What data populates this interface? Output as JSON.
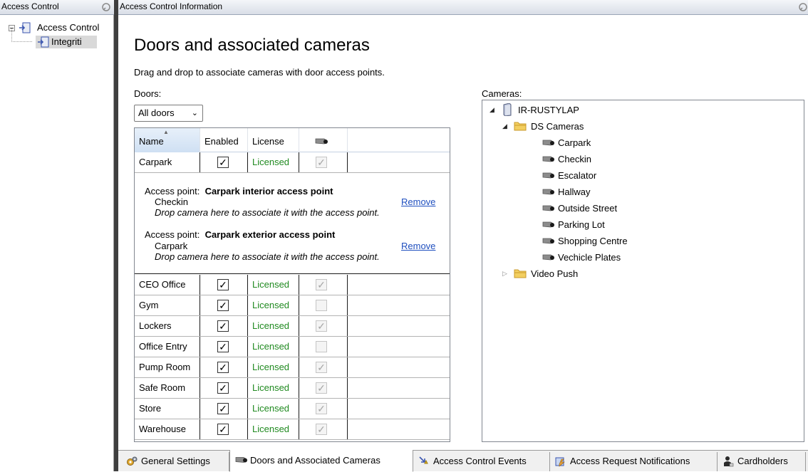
{
  "left_pane": {
    "header": "Access Control",
    "tree": {
      "root": "Access Control",
      "child": "Integriti"
    }
  },
  "right_pane": {
    "header": "Access Control Information",
    "title": "Doors and associated cameras",
    "subtitle": "Drag and drop to associate cameras with door access points.",
    "doors_label": "Doors:",
    "doors_filter": "All doors",
    "cameras_label": "Cameras:"
  },
  "doors_table": {
    "columns": [
      "Name",
      "Enabled",
      "License"
    ],
    "license_text": "Licensed",
    "rows": [
      {
        "name": "Carpark",
        "enabled": true,
        "license": "Licensed",
        "camera": true
      },
      {
        "name": "CEO Office",
        "enabled": true,
        "license": "Licensed",
        "camera": true
      },
      {
        "name": "Gym",
        "enabled": true,
        "license": "Licensed",
        "camera": false
      },
      {
        "name": "Lockers",
        "enabled": true,
        "license": "Licensed",
        "camera": true
      },
      {
        "name": "Office Entry",
        "enabled": true,
        "license": "Licensed",
        "camera": false
      },
      {
        "name": "Pump Room",
        "enabled": true,
        "license": "Licensed",
        "camera": true
      },
      {
        "name": "Safe Room",
        "enabled": true,
        "license": "Licensed",
        "camera": true
      },
      {
        "name": "Store",
        "enabled": true,
        "license": "Licensed",
        "camera": true
      },
      {
        "name": "Warehouse",
        "enabled": true,
        "license": "Licensed",
        "camera": true
      }
    ],
    "carpark_details": {
      "access_points": [
        {
          "prefix": "Access point:",
          "name": "Carpark interior access point",
          "camera": "Checkin",
          "drop_hint": "Drop camera here to associate it with the access point.",
          "remove": "Remove"
        },
        {
          "prefix": "Access point:",
          "name": "Carpark exterior access point",
          "camera": "Carpark",
          "drop_hint": "Drop camera here to associate it with the access point.",
          "remove": "Remove"
        }
      ]
    }
  },
  "cameras_tree": {
    "server": "IR-RUSTYLAP",
    "groups": [
      {
        "name": "DS Cameras",
        "expanded": true,
        "cameras": [
          "Carpark",
          "Checkin",
          "Escalator",
          "Hallway",
          "Outside Street",
          "Parking Lot",
          "Shopping Centre",
          "Vechicle Plates"
        ]
      },
      {
        "name": "Video Push",
        "expanded": false,
        "cameras": []
      }
    ]
  },
  "tabs": [
    {
      "label": "General Settings",
      "icon": "gears-icon",
      "active": false
    },
    {
      "label": "Doors and Associated Cameras",
      "icon": "camera-icon",
      "active": true
    },
    {
      "label": "Access Control Events",
      "icon": "events-icon",
      "active": false
    },
    {
      "label": "Access Request Notifications",
      "icon": "notification-icon",
      "active": false
    },
    {
      "label": "Cardholders",
      "icon": "cardholder-icon",
      "active": false
    }
  ],
  "colors": {
    "licensed_text": "#208a20",
    "link": "#1f4fbf",
    "splitter": "#3f3f3f"
  }
}
